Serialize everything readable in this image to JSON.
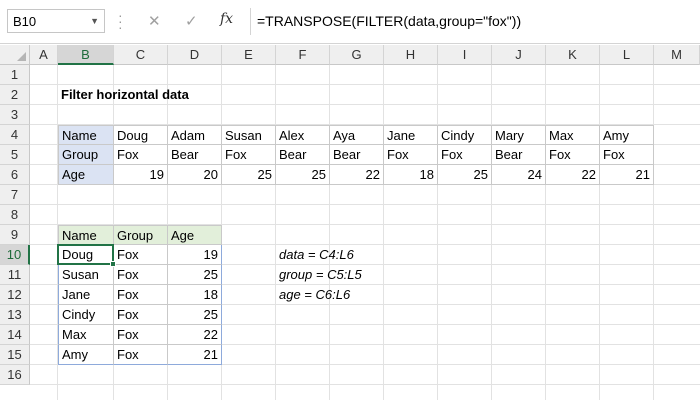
{
  "name_box": {
    "value": "B10"
  },
  "formula_bar": {
    "cancel_glyph": "✕",
    "enter_glyph": "✓",
    "fx_label": "fx",
    "formula": "=TRANSPOSE(FILTER(data,group=\"fox\"))"
  },
  "columns": [
    "A",
    "B",
    "C",
    "D",
    "E",
    "F",
    "G",
    "H",
    "I",
    "J",
    "K",
    "L",
    "M"
  ],
  "active_column": "B",
  "rows": [
    "1",
    "2",
    "3",
    "4",
    "5",
    "6",
    "7",
    "8",
    "9",
    "10",
    "11",
    "12",
    "13",
    "14",
    "15",
    "16"
  ],
  "active_row": "10",
  "sheet": {
    "title": "Filter horizontal data",
    "source": {
      "labels": [
        "Name",
        "Group",
        "Age"
      ],
      "names": [
        "Doug",
        "Adam",
        "Susan",
        "Alex",
        "Aya",
        "Jane",
        "Cindy",
        "Mary",
        "Max",
        "Amy"
      ],
      "groups": [
        "Fox",
        "Bear",
        "Fox",
        "Bear",
        "Bear",
        "Fox",
        "Fox",
        "Bear",
        "Fox",
        "Fox"
      ],
      "ages": [
        "19",
        "20",
        "25",
        "25",
        "22",
        "18",
        "25",
        "24",
        "22",
        "21"
      ]
    },
    "result": {
      "headers": [
        "Name",
        "Group",
        "Age"
      ],
      "rows": [
        [
          "Doug",
          "Fox",
          "19"
        ],
        [
          "Susan",
          "Fox",
          "25"
        ],
        [
          "Jane",
          "Fox",
          "18"
        ],
        [
          "Cindy",
          "Fox",
          "25"
        ],
        [
          "Max",
          "Fox",
          "22"
        ],
        [
          "Amy",
          "Fox",
          "21"
        ]
      ]
    },
    "notes": [
      "data = C4:L6",
      "group = C5:L5",
      "age = C6:L6"
    ]
  },
  "colors": {
    "accent": "#217346",
    "source_header_fill": "#dbe3f3",
    "result_header_fill": "#e2efda"
  }
}
